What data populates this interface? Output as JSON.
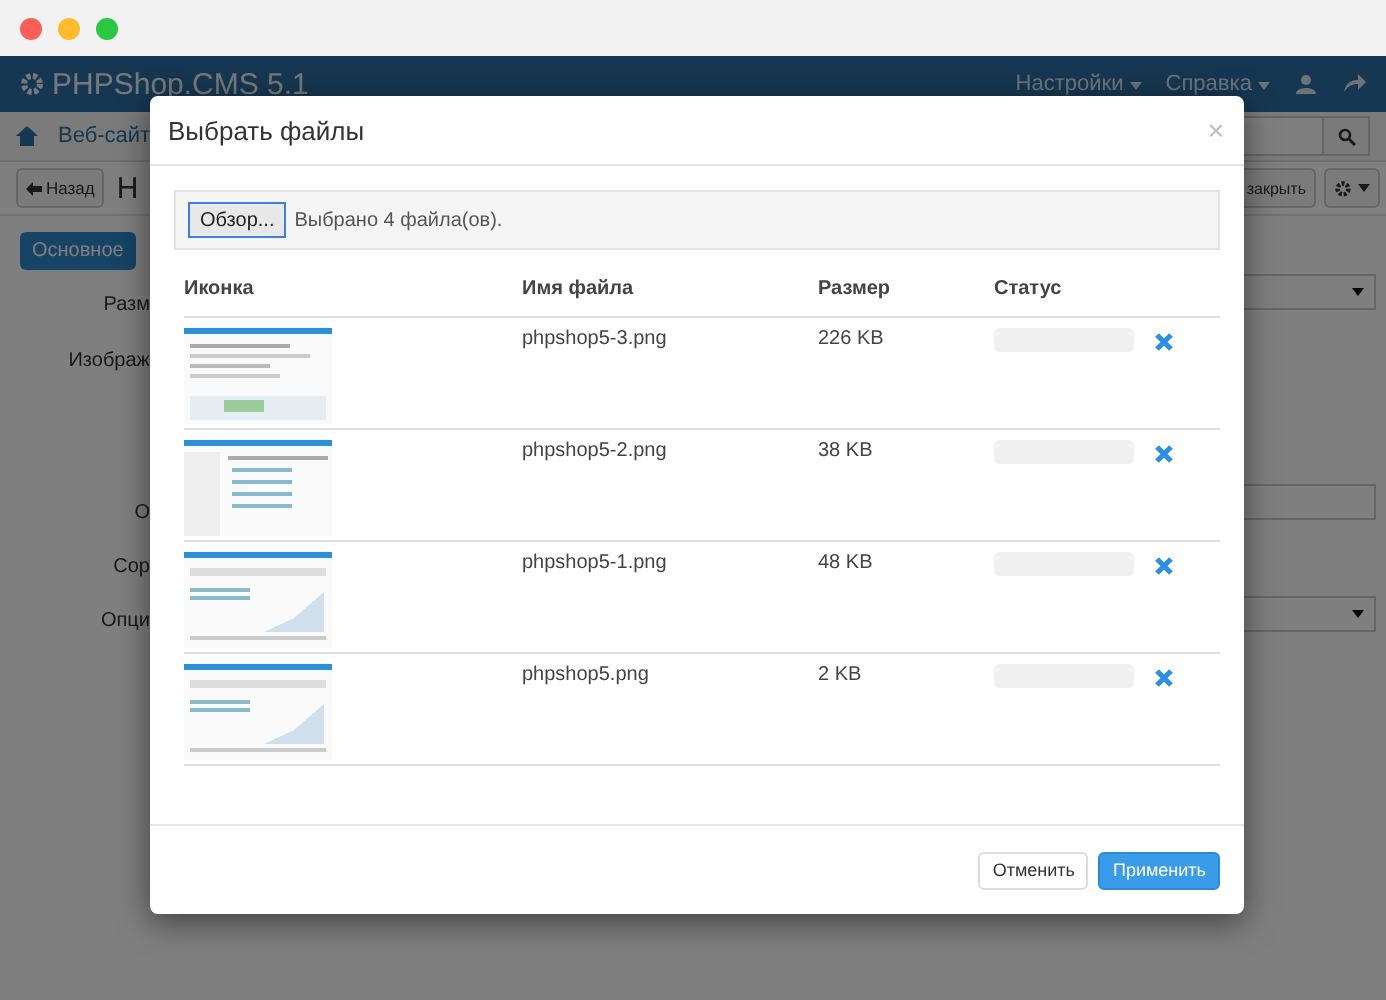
{
  "navbar": {
    "brand": "PHPShop.CMS 5.1",
    "menus": [
      "Настройки",
      "Справка"
    ]
  },
  "breadcrumb": {
    "item": "Веб-сайт"
  },
  "toolbar": {
    "back": "Назад",
    "title": "Н",
    "close": "закрыть"
  },
  "tab": "Основное",
  "form_labels": [
    "Разм",
    "Изображ",
    "О",
    "Сор",
    "Опци"
  ],
  "modal": {
    "title": "Выбрать файлы",
    "close": "×",
    "browse": "Обзор...",
    "selected_text": "Выбрано 4 файла(ов).",
    "columns": [
      "Иконка",
      "Имя файла",
      "Размер",
      "Статус"
    ],
    "rows": [
      {
        "name": "phpshop5-3.png",
        "size": "226 KB",
        "level": 0
      },
      {
        "name": "phpshop5-2.png",
        "size": "38 KB",
        "level": 0
      },
      {
        "name": "phpshop5-1.png",
        "size": "48 KB",
        "level": 0
      },
      {
        "name": "phpshop5.png",
        "size": "2 KB",
        "level": 0
      }
    ],
    "buttons": {
      "cancel": "Отменить",
      "apply": "Применить"
    }
  }
}
